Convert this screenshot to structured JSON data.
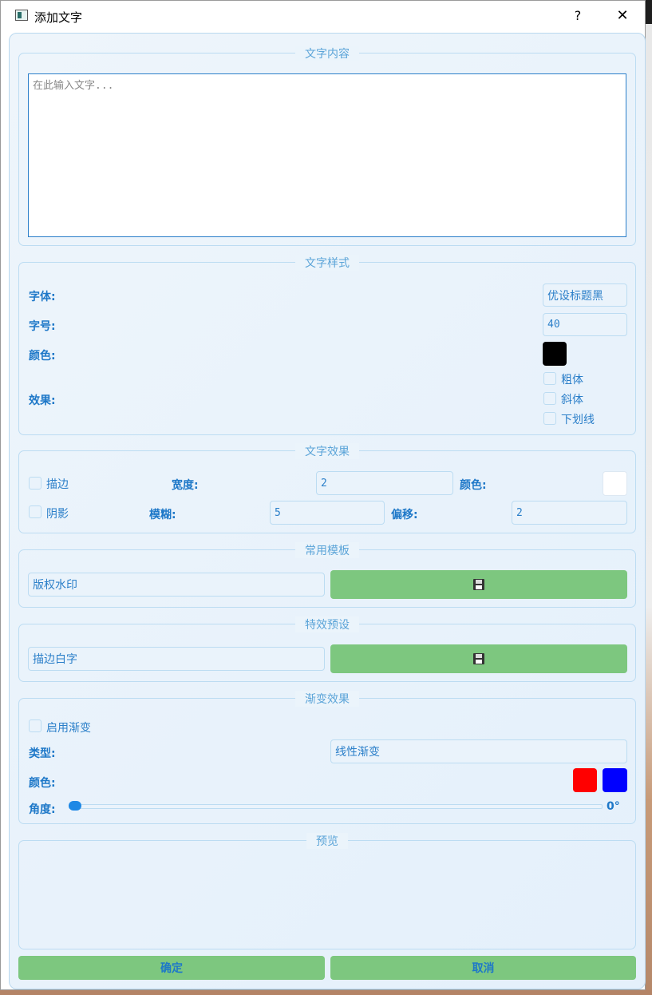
{
  "window": {
    "title": "添加文字",
    "help_label": "?",
    "close_label": "✕"
  },
  "content_group": {
    "title": "文字内容",
    "text_placeholder": "在此输入文字..."
  },
  "style_group": {
    "title": "文字样式",
    "font_label": "字体:",
    "font_value": "优设标题黑",
    "size_label": "字号:",
    "size_value": "40",
    "color_label": "颜色:",
    "color_value": "#000000",
    "effect_label": "效果:",
    "bold_label": "粗体",
    "italic_label": "斜体",
    "underline_label": "下划线"
  },
  "effect_group": {
    "title": "文字效果",
    "stroke_label": "描边",
    "stroke_width_label": "宽度:",
    "stroke_width_value": "2",
    "stroke_color_label": "颜色:",
    "stroke_color_value": "#ffffff",
    "shadow_label": "阴影",
    "shadow_blur_label": "模糊:",
    "shadow_blur_value": "5",
    "shadow_offset_label": "偏移:",
    "shadow_offset_value": "2"
  },
  "template_group": {
    "title": "常用模板",
    "selected": "版权水印",
    "save_icon": "floppy-icon"
  },
  "preset_group": {
    "title": "特效预设",
    "selected": "描边白字",
    "save_icon": "floppy-icon"
  },
  "gradient_group": {
    "title": "渐变效果",
    "enable_label": "启用渐变",
    "type_label": "类型:",
    "type_value": "线性渐变",
    "color_label": "颜色:",
    "color_start": "#ff0000",
    "color_end": "#0000ff",
    "angle_label": "角度:",
    "angle_value": "0°",
    "angle_fraction": 0
  },
  "preview_group": {
    "title": "预览"
  },
  "buttons": {
    "ok_label": "确定",
    "cancel_label": "取消"
  },
  "colors": {
    "accent": "#1e78c8",
    "button_green": "#7dc77f"
  }
}
